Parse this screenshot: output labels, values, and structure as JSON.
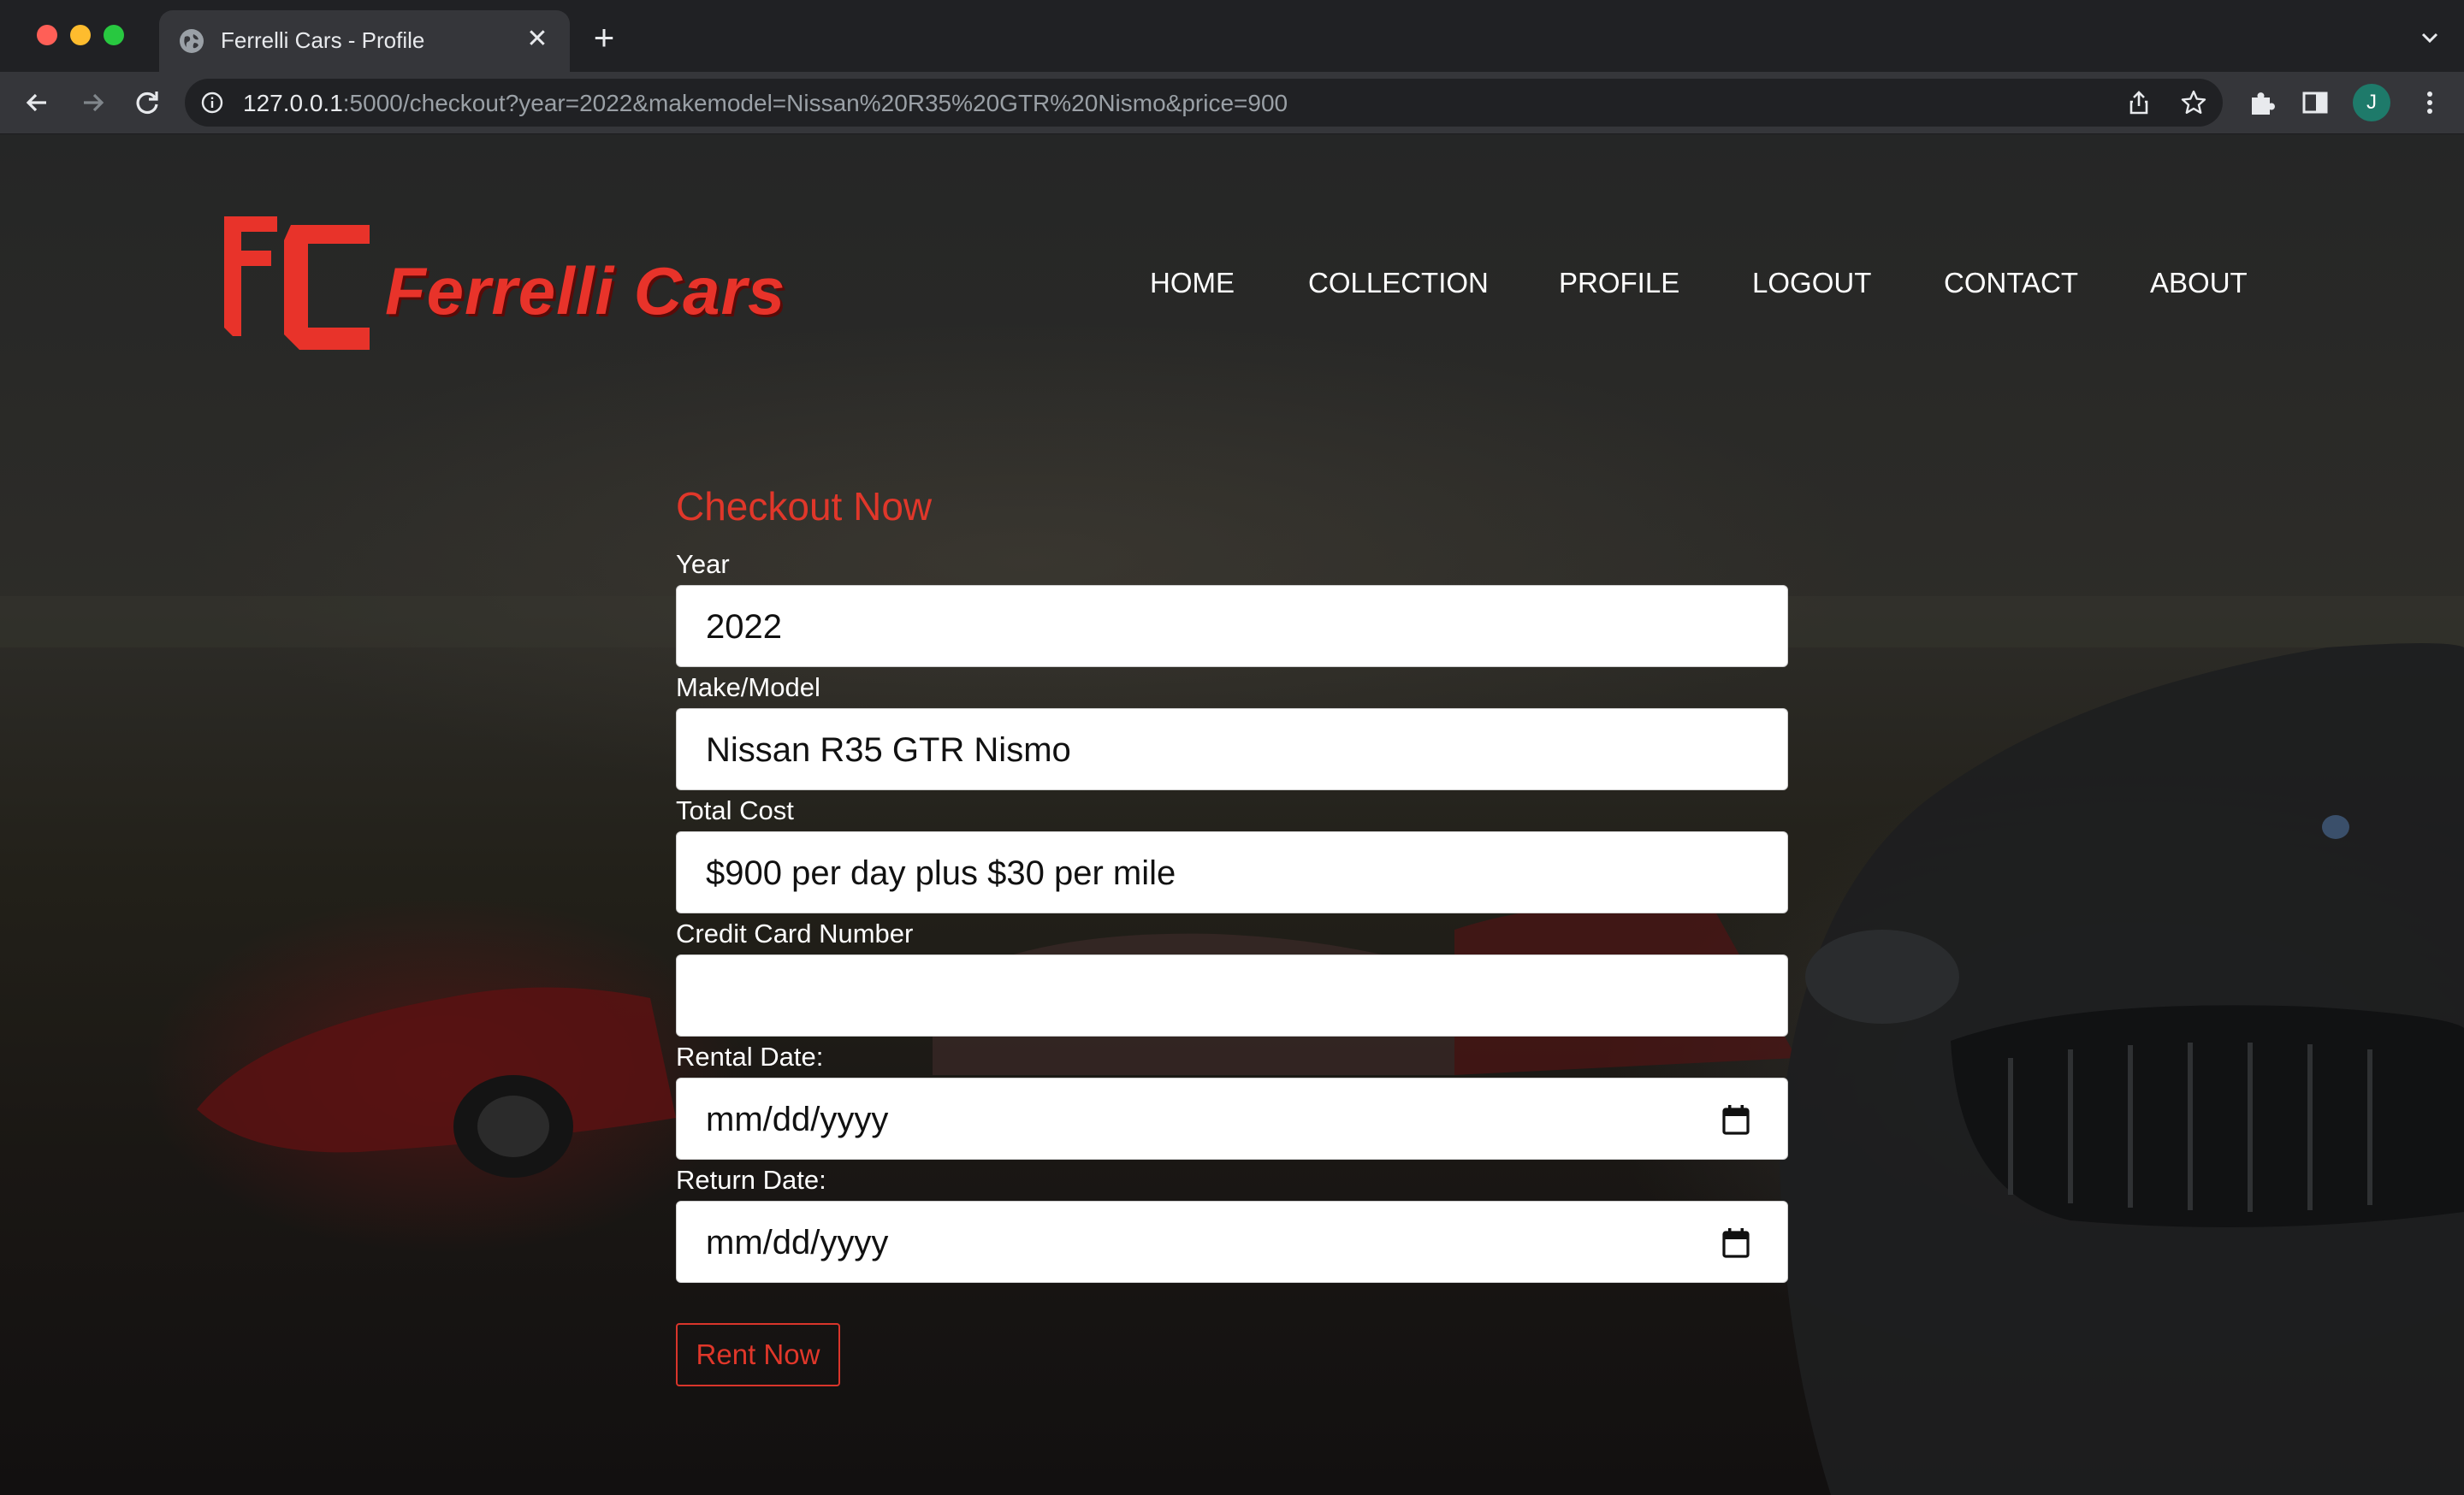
{
  "browser": {
    "tab_title": "Ferrelli Cars - Profile",
    "url_host": "127.0.0.1",
    "url_rest": ":5000/checkout?year=2022&makemodel=Nissan%20R35%20GTR%20Nismo&price=900",
    "avatar_initial": "J"
  },
  "brand": {
    "name": "Ferrelli Cars",
    "monogram": "FC",
    "color": "#e8332a"
  },
  "nav": {
    "items": [
      "HOME",
      "COLLECTION",
      "PROFILE",
      "LOGOUT",
      "CONTACT",
      "ABOUT"
    ]
  },
  "form": {
    "title": "Checkout Now",
    "year_label": "Year",
    "year_value": "2022",
    "makemodel_label": "Make/Model",
    "makemodel_value": "Nissan R35 GTR Nismo",
    "cost_label": "Total Cost",
    "cost_value": "$900 per day plus $30 per mile",
    "card_label": "Credit Card Number",
    "card_value": "",
    "rental_label": "Rental Date:",
    "rental_placeholder": "mm/dd/yyyy",
    "return_label": "Return Date:",
    "return_placeholder": "mm/dd/yyyy",
    "submit_label": "Rent Now"
  },
  "icons": {
    "back": "arrow-left-icon",
    "forward": "arrow-right-icon",
    "reload": "reload-icon",
    "calendar": "calendar-icon"
  }
}
